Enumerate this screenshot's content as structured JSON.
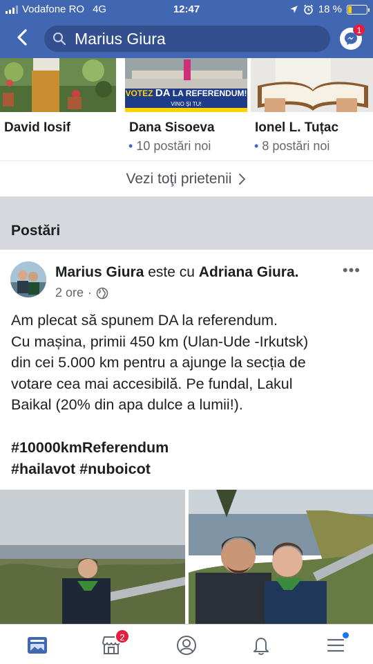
{
  "status_bar": {
    "carrier": "Vodafone RO",
    "network": "4G",
    "time": "12:47",
    "battery": "18 %"
  },
  "search": {
    "query": "Marius Giura"
  },
  "messenger": {
    "badge": "1"
  },
  "friends": [
    {
      "name": "David Iosif",
      "new_posts": ""
    },
    {
      "name": "Dana Sisoeva",
      "new_posts": "10 postări noi",
      "banner": {
        "line1": "VOTEZ",
        "line2": "DA",
        "line3": "LA",
        "line4": "REFERENDUM!",
        "line5": "VINO ȘI TU!"
      }
    },
    {
      "name": "Ionel L. Tuțac",
      "new_posts": "8 postări noi"
    }
  ],
  "see_all": "Vezi toţi prietenii",
  "section_title": "Postări",
  "post": {
    "author": "Marius Giura",
    "with_text": "este cu",
    "tagged": "Adriana Giura.",
    "time": "2 ore",
    "body_lines": [
      "Am plecat să spunem DA la referendum.",
      "Cu mașina, primii 450 km (Ulan-Ude -Irkutsk)",
      "din cei 5.000 km pentru a ajunge la secția de",
      "votare cea mai accesibilă. Pe fundal, Lakul",
      "Baikal (20% din apa dulce a lumii!)."
    ],
    "hashtags": [
      "#10000kmReferendum",
      "#hailavot #nuboicot"
    ]
  },
  "nav": {
    "marketplace_badge": "2"
  },
  "colors": {
    "brand": "#4267b2",
    "badge": "#e41e3f",
    "accent_dot": "#1877f2"
  }
}
